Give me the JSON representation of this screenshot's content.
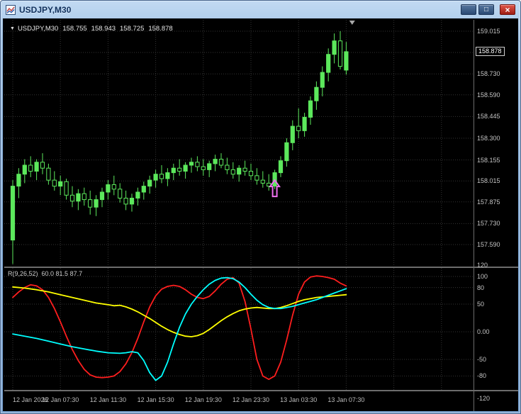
{
  "window": {
    "title": "USDJPY,M30",
    "controls": {
      "minimize": "_",
      "maximize": "□",
      "close": "×"
    }
  },
  "ohlc_line": {
    "marker": "▼",
    "symbol": "USDJPY,M30",
    "open": "158.755",
    "high": "158.943",
    "low": "158.725",
    "close": "158.878"
  },
  "indicator_label": {
    "name": "R(9,26,52)",
    "values": "60.0 81.5 87.7"
  },
  "chart_data": {
    "type": "candlestick",
    "title": "USDJPY,M30",
    "timeframe": "M30",
    "legend_position": "none",
    "grid": true,
    "x_axis": {
      "labels": [
        {
          "text": "12 Jan 2026",
          "index": 0
        },
        {
          "text": "12 Jan 07:30",
          "index": 8
        },
        {
          "text": "12 Jan 11:30",
          "index": 16
        },
        {
          "text": "12 Jan 15:30",
          "index": 24
        },
        {
          "text": "12 Jan 19:30",
          "index": 32
        },
        {
          "text": "12 Jan 23:30",
          "index": 40
        },
        {
          "text": "13 Jan 03:30",
          "index": 48
        },
        {
          "text": "13 Jan 07:30",
          "index": 56
        }
      ],
      "extra_grid_indices": [
        64,
        72
      ]
    },
    "price_pane": {
      "ylim": [
        157.42,
        159.06
      ],
      "axis_labels": [
        "159.015",
        "158.730",
        "158.590",
        "158.445",
        "158.300",
        "158.155",
        "158.015",
        "157.875",
        "157.730",
        "157.590"
      ],
      "grid_prices": [
        159.015,
        158.873,
        158.73,
        158.59,
        158.445,
        158.3,
        158.155,
        158.015,
        157.875,
        157.73,
        157.59
      ],
      "current_price": 158.878,
      "current_price_display": "158.878",
      "shift_marker_index": 57,
      "signal_arrow": {
        "candle_index": 44,
        "price": 158.02,
        "direction": "up"
      },
      "candles": [
        [
          157.62,
          158.02,
          157.46,
          157.98
        ],
        [
          157.98,
          158.1,
          157.9,
          158.06
        ],
        [
          158.06,
          158.16,
          158.0,
          158.12
        ],
        [
          158.12,
          158.18,
          158.04,
          158.08
        ],
        [
          158.08,
          158.16,
          158.02,
          158.14
        ],
        [
          158.14,
          158.2,
          158.06,
          158.1
        ],
        [
          158.1,
          158.13,
          157.99,
          158.02
        ],
        [
          158.02,
          158.08,
          157.95,
          157.98
        ],
        [
          157.98,
          158.05,
          157.92,
          158.01
        ],
        [
          158.01,
          158.03,
          157.89,
          157.92
        ],
        [
          157.92,
          157.98,
          157.84,
          157.88
        ],
        [
          157.88,
          157.96,
          157.82,
          157.93
        ],
        [
          157.93,
          157.97,
          157.85,
          157.89
        ],
        [
          157.89,
          157.95,
          157.79,
          157.84
        ],
        [
          157.84,
          157.92,
          157.78,
          157.89
        ],
        [
          157.89,
          157.97,
          157.84,
          157.94
        ],
        [
          157.94,
          158.02,
          157.89,
          157.99
        ],
        [
          157.99,
          158.05,
          157.92,
          157.96
        ],
        [
          157.96,
          158.0,
          157.87,
          157.9
        ],
        [
          157.9,
          157.95,
          157.82,
          157.86
        ],
        [
          157.86,
          157.93,
          157.81,
          157.9
        ],
        [
          157.9,
          157.97,
          157.85,
          157.94
        ],
        [
          157.94,
          158.01,
          157.89,
          157.98
        ],
        [
          157.98,
          158.05,
          157.93,
          158.02
        ],
        [
          158.02,
          158.09,
          157.97,
          158.06
        ],
        [
          158.06,
          158.12,
          158.0,
          158.03
        ],
        [
          158.03,
          158.1,
          157.98,
          158.07
        ],
        [
          158.07,
          158.13,
          158.02,
          158.1
        ],
        [
          158.1,
          158.16,
          158.05,
          158.08
        ],
        [
          158.08,
          158.14,
          158.03,
          158.12
        ],
        [
          158.12,
          158.17,
          158.07,
          158.14
        ],
        [
          158.14,
          158.18,
          158.08,
          158.11
        ],
        [
          158.11,
          158.16,
          158.05,
          158.09
        ],
        [
          158.09,
          158.15,
          158.04,
          158.13
        ],
        [
          158.13,
          158.19,
          158.08,
          158.16
        ],
        [
          158.16,
          158.2,
          158.1,
          158.12
        ],
        [
          158.12,
          158.17,
          158.06,
          158.09
        ],
        [
          158.09,
          158.14,
          158.03,
          158.06
        ],
        [
          158.06,
          158.12,
          158.01,
          158.1
        ],
        [
          158.1,
          158.15,
          158.05,
          158.08
        ],
        [
          158.08,
          158.13,
          158.02,
          158.05
        ],
        [
          158.05,
          158.1,
          157.99,
          158.02
        ],
        [
          158.02,
          158.08,
          157.97,
          158.0
        ],
        [
          158.0,
          158.06,
          157.95,
          157.98
        ],
        [
          157.98,
          158.09,
          157.96,
          158.07
        ],
        [
          158.07,
          158.18,
          158.04,
          158.15
        ],
        [
          158.15,
          158.3,
          158.11,
          158.27
        ],
        [
          158.27,
          158.42,
          158.22,
          158.38
        ],
        [
          158.38,
          158.5,
          158.3,
          158.35
        ],
        [
          158.35,
          158.47,
          158.31,
          158.44
        ],
        [
          158.44,
          158.58,
          158.39,
          158.55
        ],
        [
          158.55,
          158.68,
          158.49,
          158.64
        ],
        [
          158.64,
          158.78,
          158.58,
          158.74
        ],
        [
          158.74,
          158.9,
          158.68,
          158.86
        ],
        [
          158.86,
          159.0,
          158.8,
          158.95
        ],
        [
          158.95,
          159.015,
          158.76,
          158.78
        ],
        [
          158.755,
          158.943,
          158.725,
          158.878
        ]
      ]
    },
    "indicator_pane": {
      "name": "R(9,26,52)",
      "current_values": [
        60.0,
        81.5,
        87.7
      ],
      "ylim": [
        -120,
        120
      ],
      "axis": [
        {
          "v": 120,
          "t": "120"
        },
        {
          "v": 100,
          "t": "100"
        },
        {
          "v": 80,
          "t": "80"
        },
        {
          "v": 50,
          "t": "50"
        },
        {
          "v": 0,
          "t": "0.00"
        },
        {
          "v": -50,
          "t": "-50"
        },
        {
          "v": -80,
          "t": "-80"
        },
        {
          "v": -120,
          "t": "-120"
        }
      ],
      "grid_values": [
        100,
        80,
        50,
        0,
        -50,
        -80
      ],
      "series": [
        {
          "name": "fast-red",
          "color": "#ff1e1e",
          "points": [
            [
              0,
              62
            ],
            [
              1,
              72
            ],
            [
              2,
              80
            ],
            [
              3,
              85
            ],
            [
              4,
              83
            ],
            [
              5,
              76
            ],
            [
              6,
              62
            ],
            [
              7,
              42
            ],
            [
              8,
              18
            ],
            [
              9,
              -8
            ],
            [
              10,
              -32
            ],
            [
              11,
              -52
            ],
            [
              12,
              -68
            ],
            [
              13,
              -78
            ],
            [
              14,
              -82
            ],
            [
              15,
              -83
            ],
            [
              16,
              -82
            ],
            [
              17,
              -80
            ],
            [
              18,
              -72
            ],
            [
              19,
              -58
            ],
            [
              20,
              -38
            ],
            [
              21,
              -12
            ],
            [
              22,
              18
            ],
            [
              23,
              45
            ],
            [
              24,
              65
            ],
            [
              25,
              77
            ],
            [
              26,
              82
            ],
            [
              27,
              84
            ],
            [
              28,
              82
            ],
            [
              29,
              76
            ],
            [
              30,
              68
            ],
            [
              31,
              62
            ],
            [
              32,
              60
            ],
            [
              33,
              64
            ],
            [
              34,
              74
            ],
            [
              35,
              86
            ],
            [
              36,
              95
            ],
            [
              37,
              98
            ],
            [
              38,
              88
            ],
            [
              39,
              55
            ],
            [
              40,
              5
            ],
            [
              41,
              -50
            ],
            [
              42,
              -80
            ],
            [
              43,
              -86
            ],
            [
              44,
              -80
            ],
            [
              45,
              -55
            ],
            [
              46,
              -15
            ],
            [
              47,
              30
            ],
            [
              48,
              68
            ],
            [
              49,
              90
            ],
            [
              50,
              99
            ],
            [
              51,
              101
            ],
            [
              52,
              100
            ],
            [
              53,
              98
            ],
            [
              54,
              95
            ],
            [
              55,
              88
            ],
            [
              56,
              83
            ]
          ]
        },
        {
          "name": "mid-yellow",
          "color": "#ffff00",
          "points": [
            [
              0,
              81
            ],
            [
              2,
              79
            ],
            [
              4,
              76
            ],
            [
              6,
              72
            ],
            [
              8,
              67
            ],
            [
              10,
              62
            ],
            [
              12,
              57
            ],
            [
              14,
              52
            ],
            [
              16,
              49
            ],
            [
              17,
              47
            ],
            [
              18,
              48
            ],
            [
              19,
              45
            ],
            [
              20,
              41
            ],
            [
              21,
              36
            ],
            [
              22,
              30
            ],
            [
              23,
              24
            ],
            [
              24,
              17
            ],
            [
              25,
              10
            ],
            [
              26,
              4
            ],
            [
              27,
              -1
            ],
            [
              28,
              -5
            ],
            [
              29,
              -8
            ],
            [
              30,
              -9
            ],
            [
              31,
              -7
            ],
            [
              32,
              -3
            ],
            [
              33,
              4
            ],
            [
              34,
              12
            ],
            [
              35,
              20
            ],
            [
              36,
              27
            ],
            [
              37,
              33
            ],
            [
              38,
              38
            ],
            [
              39,
              41
            ],
            [
              40,
              43
            ],
            [
              41,
              44
            ],
            [
              42,
              43
            ],
            [
              43,
              42
            ],
            [
              44,
              42
            ],
            [
              45,
              44
            ],
            [
              46,
              47
            ],
            [
              47,
              51
            ],
            [
              48,
              55
            ],
            [
              49,
              58
            ],
            [
              50,
              60
            ],
            [
              51,
              62
            ],
            [
              52,
              63
            ],
            [
              53,
              64
            ],
            [
              54,
              65
            ],
            [
              55,
              66
            ],
            [
              56,
              67
            ]
          ]
        },
        {
          "name": "slow-cyan",
          "color": "#00ffff",
          "points": [
            [
              0,
              -4
            ],
            [
              2,
              -8
            ],
            [
              4,
              -12
            ],
            [
              6,
              -17
            ],
            [
              8,
              -22
            ],
            [
              10,
              -27
            ],
            [
              12,
              -31
            ],
            [
              14,
              -35
            ],
            [
              16,
              -38
            ],
            [
              18,
              -39
            ],
            [
              19,
              -38
            ],
            [
              20,
              -36
            ],
            [
              21,
              -38
            ],
            [
              22,
              -52
            ],
            [
              23,
              -74
            ],
            [
              24,
              -88
            ],
            [
              25,
              -80
            ],
            [
              26,
              -55
            ],
            [
              27,
              -22
            ],
            [
              28,
              8
            ],
            [
              29,
              32
            ],
            [
              30,
              50
            ],
            [
              31,
              64
            ],
            [
              32,
              76
            ],
            [
              33,
              86
            ],
            [
              34,
              93
            ],
            [
              35,
              97
            ],
            [
              36,
              98
            ],
            [
              37,
              96
            ],
            [
              38,
              90
            ],
            [
              39,
              80
            ],
            [
              40,
              68
            ],
            [
              41,
              57
            ],
            [
              42,
              49
            ],
            [
              43,
              44
            ],
            [
              44,
              42
            ],
            [
              45,
              42
            ],
            [
              46,
              44
            ],
            [
              47,
              46
            ],
            [
              48,
              49
            ],
            [
              49,
              52
            ],
            [
              50,
              55
            ],
            [
              51,
              58
            ],
            [
              52,
              62
            ],
            [
              53,
              66
            ],
            [
              54,
              70
            ],
            [
              55,
              74
            ],
            [
              56,
              78
            ]
          ]
        }
      ]
    },
    "colors": {
      "candle": "#5ce85c",
      "bear_fill": "#000000",
      "arrow": "#f070f0",
      "grid": "#343434",
      "axis_text": "#c4c4c4",
      "background": "#000000"
    }
  }
}
